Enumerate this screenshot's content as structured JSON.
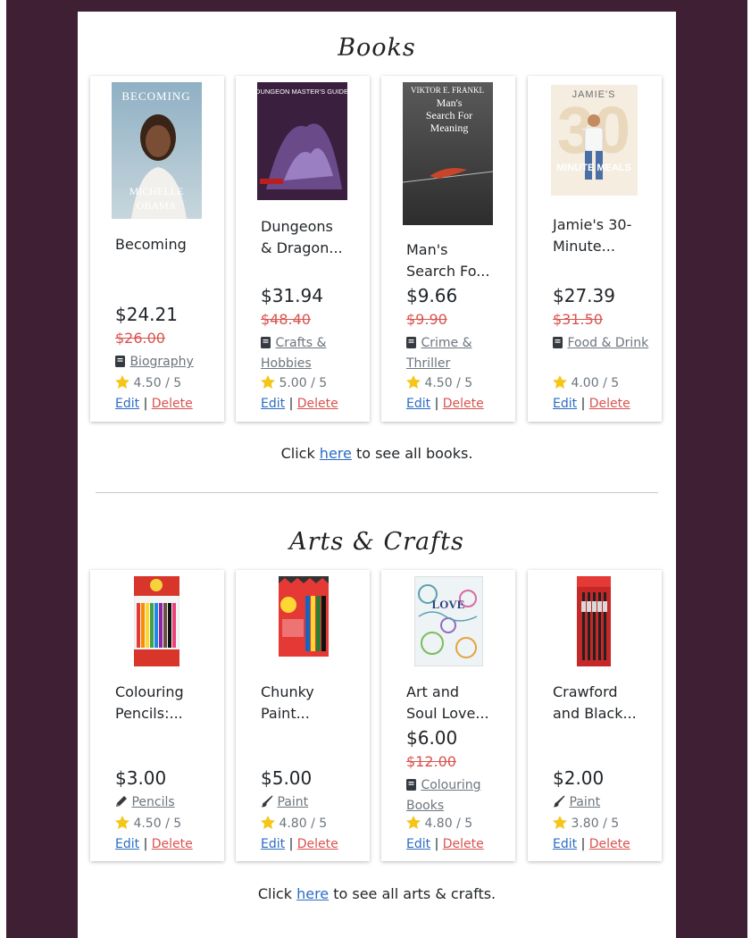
{
  "books": {
    "title": "Books",
    "see_all_prefix": "Click ",
    "see_all_link": "here",
    "see_all_suffix": " to see all books.",
    "items": [
      {
        "cover_top_text": "BECOMING",
        "cover_bottom_text_1": "MICHELLE",
        "cover_bottom_text_2": "OBAMA",
        "title": "Becoming",
        "price": "$24.21",
        "old_price": "$26.00",
        "category": "Biography",
        "category_icon": "book-icon",
        "rating": "4.50 / 5",
        "edit": "Edit",
        "delete": "Delete"
      },
      {
        "cover_top_text": "DUNGEON MASTER'S GUIDE",
        "title": "Dungeons\n& Dragon...",
        "price": "$31.94",
        "old_price": "$48.40",
        "category": "Crafts & Hobbies",
        "category_icon": "book-icon",
        "rating": "5.00 / 5",
        "edit": "Edit",
        "delete": "Delete"
      },
      {
        "cover_top_text": "VIKTOR E. FRANKL",
        "cover_mid_text_1": "Man's",
        "cover_mid_text_2": "Search For",
        "cover_mid_text_3": "Meaning",
        "title": "Man's\nSearch Fo...",
        "price": "$9.66",
        "old_price": "$9.90",
        "category": "Crime & Thriller",
        "category_icon": "book-icon",
        "rating": "4.50 / 5",
        "edit": "Edit",
        "delete": "Delete"
      },
      {
        "cover_top_text": "JAMIE'S",
        "cover_mid_text": "30",
        "cover_bottom_text": "MINUTE MEALS",
        "title": "Jamie's 30-\nMinute...",
        "price": "$27.39",
        "old_price": "$31.50",
        "category": "Food & Drink",
        "category_icon": "book-icon",
        "rating": "4.00 / 5",
        "edit": "Edit",
        "delete": "Delete"
      }
    ]
  },
  "arts": {
    "title": "Arts & Crafts",
    "see_all_prefix": "Click ",
    "see_all_link": "here",
    "see_all_suffix": " to see all arts & crafts.",
    "items": [
      {
        "title": "Colouring\nPencils:...",
        "price": "$3.00",
        "old_price": "",
        "category": "Pencils",
        "category_icon": "pencil-icon",
        "rating": "4.50 / 5",
        "edit": "Edit",
        "delete": "Delete"
      },
      {
        "title": "Chunky\nPaint...",
        "price": "$5.00",
        "old_price": "",
        "category": "Paint",
        "category_icon": "paint-brush-icon",
        "rating": "4.80 / 5",
        "edit": "Edit",
        "delete": "Delete"
      },
      {
        "cover_top_text": "LOVE",
        "title": "Art and\nSoul Love...",
        "price": "$6.00",
        "old_price": "$12.00",
        "category": "Colouring Books",
        "category_icon": "book-icon",
        "rating": "4.80 / 5",
        "edit": "Edit",
        "delete": "Delete"
      },
      {
        "title": "Crawford\nand Black...",
        "price": "$2.00",
        "old_price": "",
        "category": "Paint",
        "category_icon": "paint-brush-icon",
        "rating": "3.80 / 5",
        "edit": "Edit",
        "delete": "Delete"
      }
    ]
  },
  "colors": {
    "page_bg": "#3f1f33",
    "card_bg": "#ffffff",
    "edit_link": "#2b6cc4",
    "delete_link": "#d9534f",
    "old_price": "#d9534f",
    "star": "#f5c518"
  }
}
